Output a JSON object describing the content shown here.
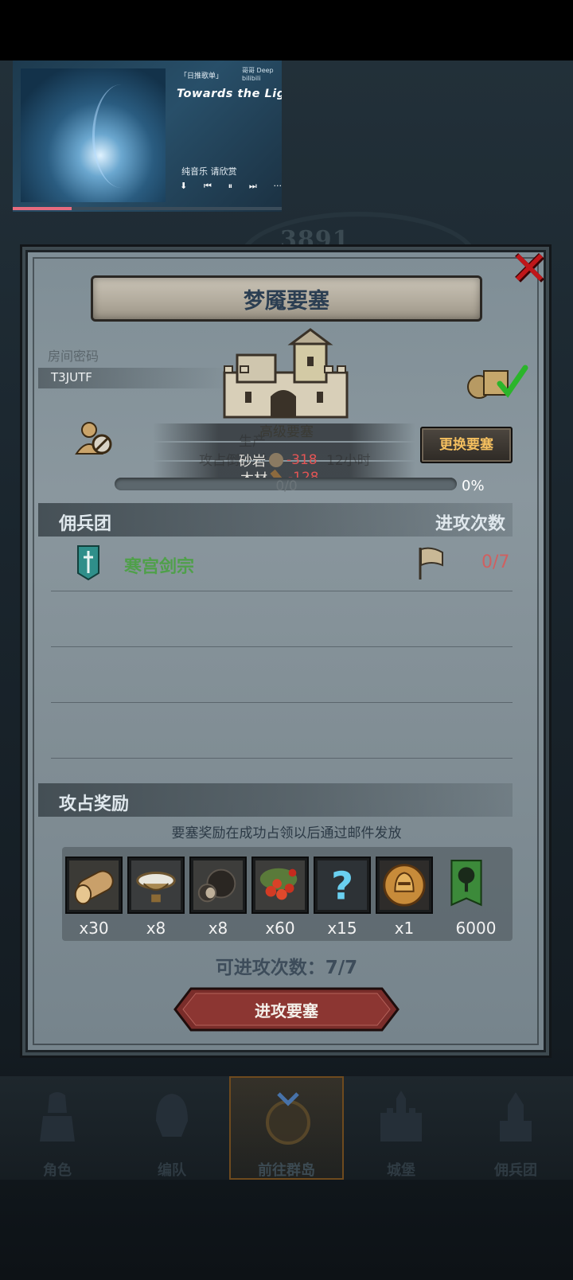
{
  "music": {
    "tag": "「日推歌单」",
    "brand": "哥哥 Deep bilibili",
    "song": "Towards the Light",
    "subtitle": "纯音乐 请欣赏",
    "progress": 0.22
  },
  "background": {
    "number": "3891"
  },
  "dialog": {
    "title": "梦魇要塞",
    "room_label": "房间密码",
    "room_code": "T3JUTF",
    "fortress_level": "高级要塞",
    "ghost_stats": [
      "生产",
      "攻占倒计时",
      "12小时"
    ],
    "resources": [
      {
        "name": "砂岩",
        "value": "-318"
      },
      {
        "name": "木材",
        "value": "-128"
      }
    ],
    "change_button": "更换要塞",
    "progress_count": "0/0",
    "progress_percent": "0%",
    "mercenary_section": "佣兵团",
    "attack_count_header": "进攻次数",
    "guild": {
      "name": "寒宫剑宗",
      "attacks": "0/7"
    },
    "reward_section": "攻占奖励",
    "reward_note": "要塞奖励在成功占领以后通过邮件发放",
    "rewards": [
      {
        "icon": "log-icon",
        "qty": "x30"
      },
      {
        "icon": "bowl-icon",
        "qty": "x8"
      },
      {
        "icon": "truffle-icon",
        "qty": "x8"
      },
      {
        "icon": "berries-icon",
        "qty": "x60"
      },
      {
        "icon": "question-mark-icon",
        "qty": "x15"
      },
      {
        "icon": "helmet-medal-icon",
        "qty": "x1"
      },
      {
        "icon": "tree-banner-icon",
        "qty": "6000"
      }
    ],
    "attempts_text": "可进攻次数：7/7",
    "attack_button": "进攻要塞"
  },
  "nav": [
    {
      "label": "角色",
      "icon": "knight-icon"
    },
    {
      "label": "编队",
      "icon": "helmet-icon"
    },
    {
      "label": "前往群岛",
      "icon": "compass-icon",
      "active": true
    },
    {
      "label": "城堡",
      "icon": "castle-icon"
    },
    {
      "label": "佣兵团",
      "icon": "tower-icon"
    }
  ]
}
